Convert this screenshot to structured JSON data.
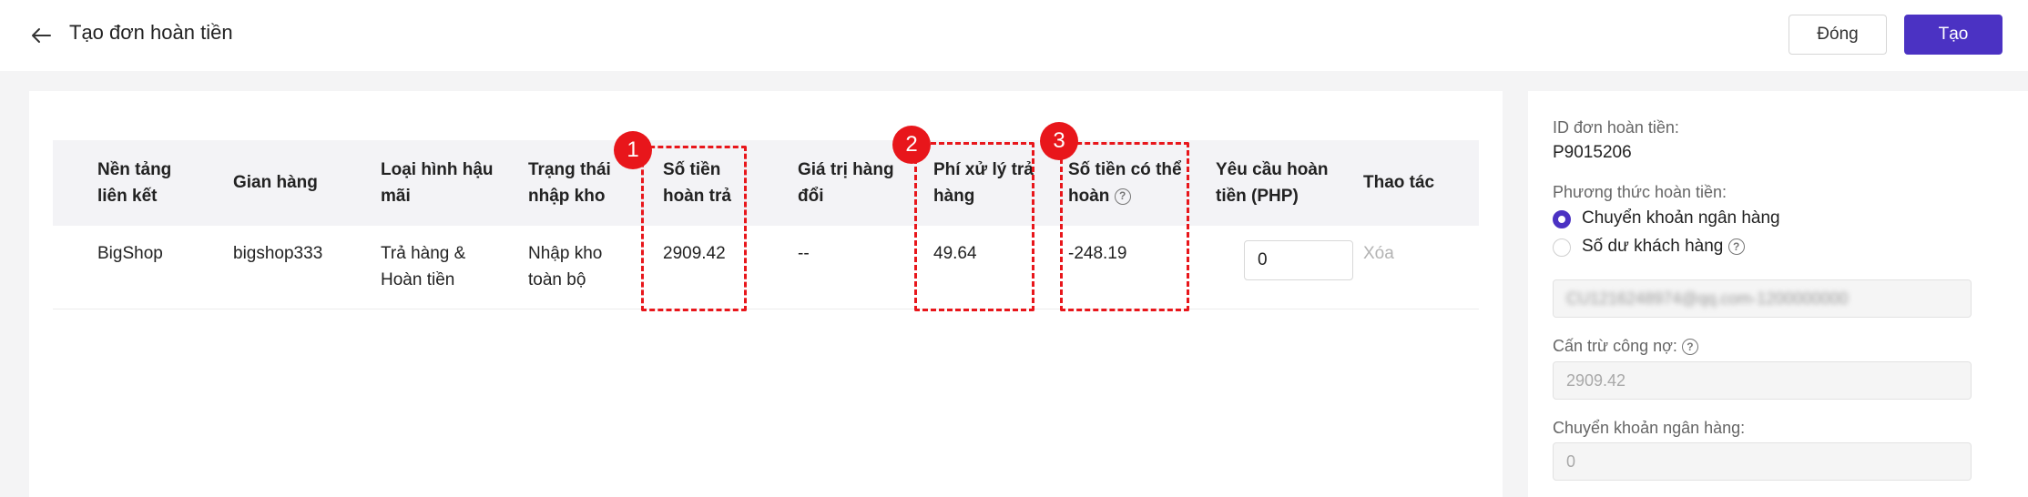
{
  "header": {
    "title": "Tạo đơn hoàn tiền",
    "close_label": "Đóng",
    "create_label": "Tạo"
  },
  "table": {
    "columns": [
      {
        "line1": "Nền tảng",
        "line2": "liên kết"
      },
      {
        "line1": "Gian hàng",
        "line2": ""
      },
      {
        "line1": "Loại hình hậu",
        "line2": "mãi"
      },
      {
        "line1": "Trạng thái",
        "line2": "nhập kho"
      },
      {
        "line1": "Số tiền",
        "line2": "hoàn trả"
      },
      {
        "line1": "Giá trị hàng",
        "line2": "đổi"
      },
      {
        "line1": "Phí xử lý trả",
        "line2": "hàng"
      },
      {
        "line1": "Số tiền có thể",
        "line2": "hoàn"
      },
      {
        "line1": "Yêu cầu hoàn",
        "line2": "tiền (PHP)"
      },
      {
        "line1": "Thao tác",
        "line2": ""
      }
    ],
    "row": {
      "platform": "BigShop",
      "shop": "bigshop333",
      "aftersale_type_1": "Trả hàng &",
      "aftersale_type_2": "Hoàn tiền",
      "stock_status_1": "Nhập kho",
      "stock_status_2": "toàn bộ",
      "refund_amount": "2909.42",
      "exchange_value": "--",
      "return_fee": "49.64",
      "refundable_amount": "-248.19",
      "refund_request": "0",
      "action": "Xóa"
    }
  },
  "annotations": {
    "badge_1": "1",
    "badge_2": "2",
    "badge_3": "3",
    "color": "#e8161b"
  },
  "side": {
    "refund_id_label": "ID đơn hoàn tiền:",
    "refund_id_value": "P9015206",
    "method_label": "Phương thức hoàn tiền:",
    "method_option_1": "Chuyển khoản ngân hàng",
    "method_option_2": "Số dư khách hàng",
    "account_masked": "CU1216248974@qq.com-1200000000",
    "debt_offset_label": "Cấn trừ công nợ:",
    "debt_offset_value": "2909.42",
    "bank_transfer_label": "Chuyển khoản ngân hàng:",
    "bank_transfer_value": "0"
  },
  "colors": {
    "accent": "#4b32c3",
    "background": "#f4f4f5"
  }
}
